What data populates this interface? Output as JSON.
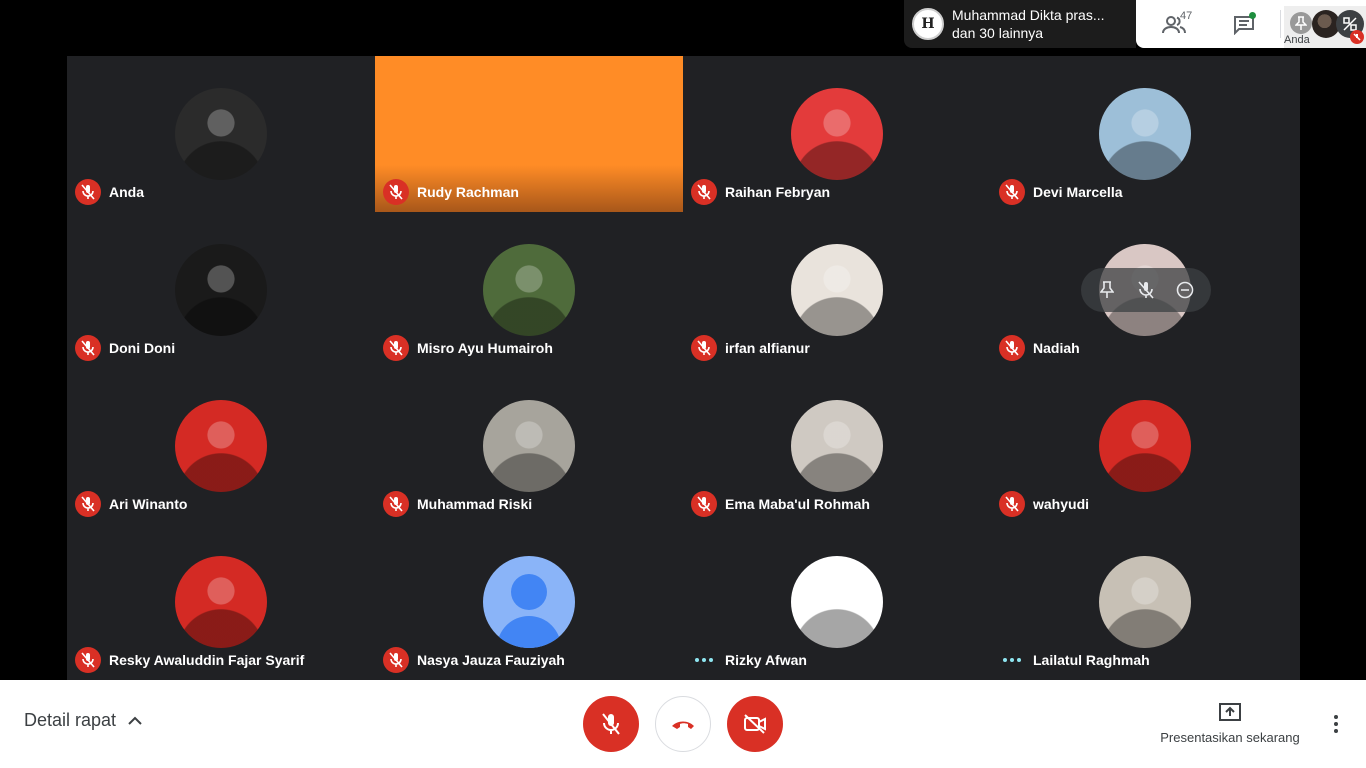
{
  "presenter": {
    "line1": "Muhammad Dikta pras...",
    "line2": "dan 30 lainnya",
    "avatar_letter": "H"
  },
  "top_actions": {
    "people_count": "47",
    "self_label": "Anda"
  },
  "participants": [
    {
      "name": "Anda",
      "status": "muted",
      "avatar": "photo",
      "color": "#2b2b2b"
    },
    {
      "name": "Rudy Rachman",
      "status": "muted",
      "avatar": "none",
      "color": "#ff8c26"
    },
    {
      "name": "Raihan Febryan",
      "status": "muted",
      "avatar": "photo",
      "color": "#e33b3b"
    },
    {
      "name": "Devi Marcella",
      "status": "muted",
      "avatar": "photo",
      "color": "#9dbfd8"
    },
    {
      "name": "Doni Doni",
      "status": "muted",
      "avatar": "photo",
      "color": "#1a1a1a"
    },
    {
      "name": "Misro Ayu Humairoh",
      "status": "muted",
      "avatar": "photo",
      "color": "#4f6b3b"
    },
    {
      "name": "irfan alfianur",
      "status": "muted",
      "avatar": "photo",
      "color": "#e9e3dc"
    },
    {
      "name": "Nadiah",
      "status": "muted",
      "avatar": "photo",
      "color": "#d9c7c4"
    },
    {
      "name": "Ari Winanto",
      "status": "muted",
      "avatar": "photo",
      "color": "#d42a24"
    },
    {
      "name": "Muhammad Riski",
      "status": "muted",
      "avatar": "photo",
      "color": "#a7a49c"
    },
    {
      "name": "Ema Maba'ul Rohmah",
      "status": "muted",
      "avatar": "photo",
      "color": "#cfc9c2"
    },
    {
      "name": "wahyudi",
      "status": "muted",
      "avatar": "photo",
      "color": "#d42a24"
    },
    {
      "name": "Resky Awaluddin Fajar Syarif",
      "status": "muted",
      "avatar": "photo",
      "color": "#d42a24"
    },
    {
      "name": "Nasya Jauza Fauziyah",
      "status": "muted",
      "avatar": "default",
      "color": "#8ab4f8"
    },
    {
      "name": "Rizky Afwan",
      "status": "speaking",
      "avatar": "photo",
      "color": "#ffffff"
    },
    {
      "name": "Lailatul Raghmah",
      "status": "speaking",
      "avatar": "photo",
      "color": "#c7c0b5"
    }
  ],
  "bottom": {
    "details_label": "Detail rapat",
    "present_label": "Presentasikan sekarang"
  },
  "colors": {
    "accent_red": "#d93025",
    "grid_bg": "#202124",
    "speaking_dots": "#8ee5f0"
  }
}
